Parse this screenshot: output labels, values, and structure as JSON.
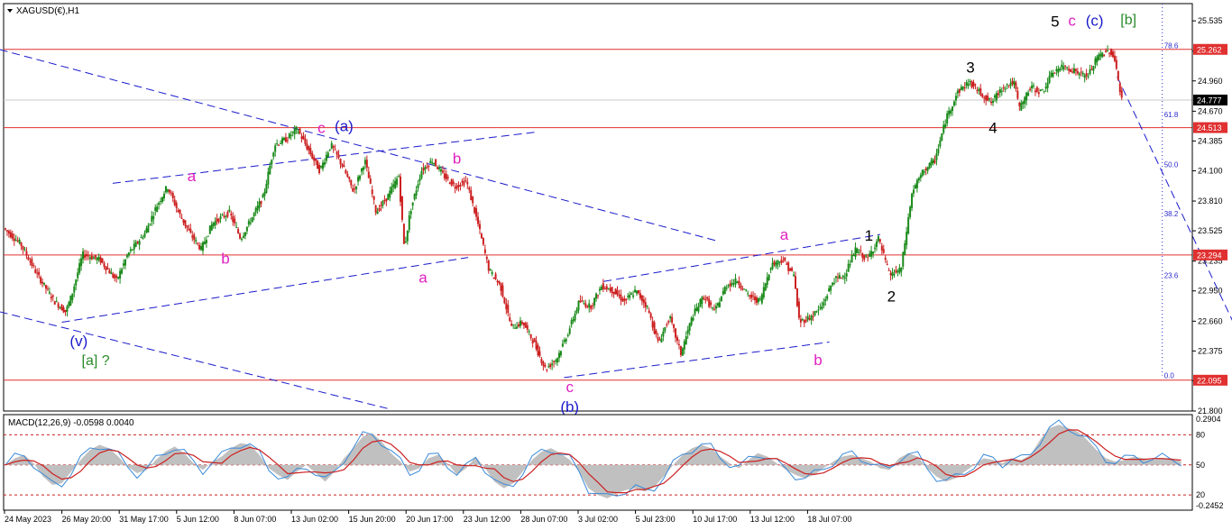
{
  "window": {
    "symbol_title": "XAGUSD(€),H1",
    "menu_icon": "triangle-down-icon"
  },
  "chart_data": {
    "type": "candlestick",
    "symbol": "XAGUSD(€)",
    "timeframe": "H1",
    "y_range": [
      21.8,
      25.7
    ],
    "y_ticks": [
      "25.535",
      "25.245",
      "24.960",
      "24.670",
      "24.385",
      "24.100",
      "23.810",
      "23.525",
      "23.235",
      "22.950",
      "22.660",
      "22.375",
      "22.090",
      "21.800"
    ],
    "x_ticks": [
      "24 May 2023",
      "26 May 20:00",
      "31 May 17:00",
      "5 Jun 12:00",
      "8 Jun 07:00",
      "13 Jun 02:00",
      "15 Jun 20:00",
      "20 Jun 17:00",
      "23 Jun 12:00",
      "28 Jun 07:00",
      "3 Jul 02:00",
      "5 Jul 23:00",
      "10 Jul 17:00",
      "13 Jul 12:00",
      "18 Jul 07:00"
    ],
    "price_path": [
      [
        0,
        23.55
      ],
      [
        3,
        23.4
      ],
      [
        6,
        23.1
      ],
      [
        9,
        22.85
      ],
      [
        11,
        22.75
      ],
      [
        12,
        22.9
      ],
      [
        14,
        23.3
      ],
      [
        17,
        23.25
      ],
      [
        20,
        23.05
      ],
      [
        22,
        23.3
      ],
      [
        25,
        23.5
      ],
      [
        27,
        23.75
      ],
      [
        29,
        23.95
      ],
      [
        31,
        23.7
      ],
      [
        33,
        23.5
      ],
      [
        35,
        23.35
      ],
      [
        37,
        23.6
      ],
      [
        40,
        23.7
      ],
      [
        42,
        23.45
      ],
      [
        44,
        23.65
      ],
      [
        46,
        23.85
      ],
      [
        48,
        24.35
      ],
      [
        50,
        24.4
      ],
      [
        52,
        24.5
      ],
      [
        54,
        24.3
      ],
      [
        56,
        24.1
      ],
      [
        58,
        24.35
      ],
      [
        60,
        24.15
      ],
      [
        62,
        23.9
      ],
      [
        64,
        24.2
      ],
      [
        66,
        23.7
      ],
      [
        68,
        23.85
      ],
      [
        70,
        24.05
      ],
      [
        71,
        23.35
      ],
      [
        72,
        23.7
      ],
      [
        74,
        24.1
      ],
      [
        76,
        24.2
      ],
      [
        78,
        24.05
      ],
      [
        80,
        23.95
      ],
      [
        82,
        24.0
      ],
      [
        84,
        23.6
      ],
      [
        86,
        23.15
      ],
      [
        88,
        23.0
      ],
      [
        90,
        22.6
      ],
      [
        92,
        22.65
      ],
      [
        94,
        22.45
      ],
      [
        96,
        22.2
      ],
      [
        98,
        22.3
      ],
      [
        100,
        22.55
      ],
      [
        102,
        22.85
      ],
      [
        104,
        22.8
      ],
      [
        106,
        23.0
      ],
      [
        108,
        22.95
      ],
      [
        110,
        22.85
      ],
      [
        112,
        22.95
      ],
      [
        114,
        22.8
      ],
      [
        116,
        22.45
      ],
      [
        118,
        22.7
      ],
      [
        120,
        22.35
      ],
      [
        122,
        22.7
      ],
      [
        124,
        22.9
      ],
      [
        126,
        22.75
      ],
      [
        128,
        23.0
      ],
      [
        130,
        23.05
      ],
      [
        132,
        22.9
      ],
      [
        134,
        22.85
      ],
      [
        136,
        23.2
      ],
      [
        138,
        23.25
      ],
      [
        140,
        23.1
      ],
      [
        141,
        22.65
      ],
      [
        143,
        22.7
      ],
      [
        145,
        22.8
      ],
      [
        147,
        23.05
      ],
      [
        149,
        23.1
      ],
      [
        151,
        23.35
      ],
      [
        153,
        23.25
      ],
      [
        155,
        23.45
      ],
      [
        157,
        23.1
      ],
      [
        159,
        23.15
      ],
      [
        161,
        23.9
      ],
      [
        163,
        24.1
      ],
      [
        165,
        24.2
      ],
      [
        167,
        24.6
      ],
      [
        169,
        24.85
      ],
      [
        171,
        24.95
      ],
      [
        173,
        24.85
      ],
      [
        175,
        24.75
      ],
      [
        177,
        24.9
      ],
      [
        179,
        24.95
      ],
      [
        180,
        24.7
      ],
      [
        182,
        24.9
      ],
      [
        184,
        24.85
      ],
      [
        186,
        25.05
      ],
      [
        188,
        25.1
      ],
      [
        190,
        25.05
      ],
      [
        192,
        25.0
      ],
      [
        194,
        25.2
      ],
      [
        196,
        25.25
      ],
      [
        197,
        25.15
      ],
      [
        198,
        24.78
      ]
    ],
    "last_price": "24.777",
    "price_levels": [
      {
        "label": "25.262",
        "value": 25.262,
        "color": "#e03030"
      },
      {
        "label": "24.513",
        "value": 24.513,
        "color": "#e03030"
      },
      {
        "label": "23.294",
        "value": 23.294,
        "color": "#e03030"
      },
      {
        "label": "22.095",
        "value": 22.095,
        "color": "#e03030"
      }
    ],
    "fib_levels": [
      {
        "label": "78.6",
        "value": 25.3
      },
      {
        "label": "61.8",
        "value": 24.64
      },
      {
        "label": "50.0",
        "value": 24.16
      },
      {
        "label": "38.2",
        "value": 23.69
      },
      {
        "label": "23.6",
        "value": 23.1
      },
      {
        "label": "0.0",
        "value": 22.14
      }
    ],
    "trend_lines": [
      {
        "from": [
          -1,
          25.26
        ],
        "to": [
          126,
          23.43
        ],
        "style": "dashed"
      },
      {
        "from": [
          -1,
          22.75
        ],
        "to": [
          68,
          21.82
        ],
        "style": "dashed"
      },
      {
        "from": [
          19,
          23.98
        ],
        "to": [
          94,
          24.47
        ],
        "style": "dashed"
      },
      {
        "from": [
          10,
          22.65
        ],
        "to": [
          82,
          23.27
        ],
        "style": "dashed"
      },
      {
        "from": [
          106,
          23.04
        ],
        "to": [
          155,
          23.49
        ],
        "style": "dashed"
      },
      {
        "from": [
          99,
          22.12
        ],
        "to": [
          146,
          22.46
        ],
        "style": "dashed"
      },
      {
        "from": [
          197,
          25.0
        ],
        "to": [
          225,
          21.8
        ],
        "style": "dashed"
      }
    ],
    "wave_labels": [
      {
        "text": "(v)",
        "x": 13,
        "y": 22.42,
        "color": "#1a1acc"
      },
      {
        "text": "[a] ?",
        "x": 16,
        "y": 22.24,
        "color": "#2a8a2a"
      },
      {
        "text": "a",
        "x": 33,
        "y": 24.0,
        "color": "#e020c0"
      },
      {
        "text": "b",
        "x": 39,
        "y": 23.21,
        "color": "#e020c0"
      },
      {
        "text": "c",
        "x": 56,
        "y": 24.46,
        "color": "#e020c0"
      },
      {
        "text": "(a)",
        "x": 60,
        "y": 24.48,
        "color": "#1a1acc"
      },
      {
        "text": "b",
        "x": 80,
        "y": 24.17,
        "color": "#e020c0"
      },
      {
        "text": "a",
        "x": 74,
        "y": 23.03,
        "color": "#e020c0"
      },
      {
        "text": "c",
        "x": 100,
        "y": 21.98,
        "color": "#e020c0"
      },
      {
        "text": "(b)",
        "x": 100,
        "y": 21.79,
        "color": "#1a1acc"
      },
      {
        "text": "a",
        "x": 138,
        "y": 23.44,
        "color": "#e020c0"
      },
      {
        "text": "b",
        "x": 144,
        "y": 22.24,
        "color": "#e020c0"
      },
      {
        "text": "1",
        "x": 153,
        "y": 23.43,
        "color": "#000000"
      },
      {
        "text": "2",
        "x": 157,
        "y": 22.85,
        "color": "#000000"
      },
      {
        "text": "3",
        "x": 171,
        "y": 25.04,
        "color": "#000000"
      },
      {
        "text": "4",
        "x": 175,
        "y": 24.46,
        "color": "#000000"
      },
      {
        "text": "5",
        "x": 186,
        "y": 25.48,
        "color": "#000000"
      },
      {
        "text": "c",
        "x": 189,
        "y": 25.49,
        "color": "#e020c0"
      },
      {
        "text": "(c)",
        "x": 193,
        "y": 25.49,
        "color": "#1a1acc"
      },
      {
        "text": "[b]",
        "x": 199,
        "y": 25.5,
        "color": "#2a8a2a"
      }
    ],
    "macd": {
      "title": "MACD(12,26,9) -0.0598 0.0040",
      "y_range": [
        -0.26,
        0.29
      ],
      "y_ticks": [
        {
          "label": "0.2904",
          "value": 0.275
        },
        {
          "label": "80",
          "value": 0.18
        },
        {
          "label": "50",
          "value": 0.0
        },
        {
          "label": "20",
          "value": -0.18
        },
        {
          "label": "-0.2452",
          "value": -0.245
        }
      ],
      "dashed_levels": [
        0.18,
        0.0,
        -0.18
      ],
      "histogram": [
        0.0,
        0.04,
        0.06,
        0.01,
        -0.07,
        -0.12,
        -0.11,
        -0.04,
        0.03,
        0.09,
        0.12,
        0.1,
        0.05,
        -0.01,
        -0.05,
        -0.03,
        0.03,
        0.08,
        0.11,
        0.07,
        0.01,
        -0.03,
        0.02,
        0.05,
        0.1,
        0.13,
        0.12,
        0.06,
        -0.02,
        -0.06,
        -0.09,
        -0.04,
        0.0,
        -0.05,
        -0.1,
        -0.04,
        0.04,
        0.1,
        0.17,
        0.19,
        0.14,
        0.07,
        0.02,
        -0.04,
        -0.02,
        0.04,
        0.06,
        0.01,
        -0.06,
        -0.02,
        0.05,
        -0.02,
        -0.1,
        -0.14,
        -0.11,
        -0.04,
        0.03,
        0.08,
        0.1,
        0.07,
        0.03,
        -0.04,
        -0.14,
        -0.18,
        -0.2,
        -0.17,
        -0.15,
        -0.14,
        -0.16,
        -0.13,
        -0.07,
        0.0,
        0.06,
        0.1,
        0.12,
        0.1,
        0.05,
        0.01,
        -0.02,
        0.03,
        0.07,
        0.05,
        0.01,
        -0.03,
        -0.06,
        -0.08,
        -0.06,
        -0.02,
        0.02,
        0.05,
        0.06,
        0.04,
        0.02,
        -0.02,
        -0.03,
        0.04,
        0.07,
        0.05,
        -0.02,
        -0.07,
        -0.1,
        -0.08,
        -0.04,
        0.0,
        0.04,
        0.03,
        0.01,
        0.04,
        0.03,
        0.06,
        0.15,
        0.22,
        0.24,
        0.22,
        0.2,
        0.15,
        0.09,
        0.04,
        0.02,
        0.03,
        0.05,
        0.04,
        0.03,
        0.04,
        0.04,
        0.02
      ]
    }
  }
}
